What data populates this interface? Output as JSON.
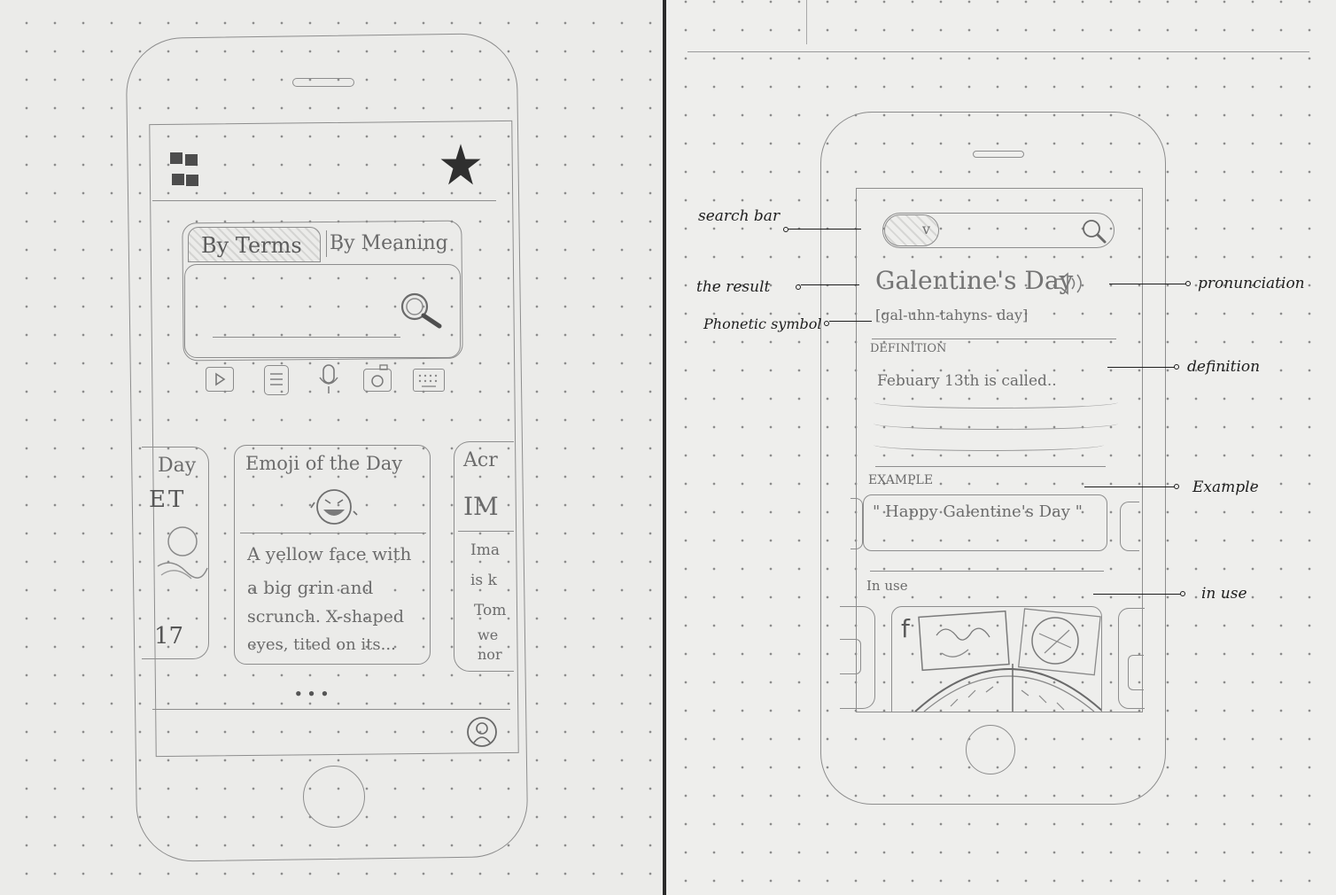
{
  "left_sketch": {
    "tabs": {
      "by_terms": "By Terms",
      "by_meaning": "By Meaning"
    },
    "cards": {
      "left_partial": {
        "title": "Day",
        "big": "ET",
        "bottom": "17"
      },
      "center": {
        "title": "Emoji of the Day",
        "lines": [
          "A yellow face with",
          "a big grin and",
          "scrunch. X-shaped",
          "eyes, tited on its..."
        ]
      },
      "right_partial": {
        "title": "Acr",
        "big": "IM",
        "lines": [
          "Ima",
          "is k",
          "Tom",
          "we",
          "nor"
        ]
      }
    },
    "page_dots": "• • •",
    "toolbar_icons": [
      "video-icon",
      "document-icon",
      "microphone-icon",
      "camera-icon",
      "keyboard-icon"
    ]
  },
  "right_sketch": {
    "search_dropdown": "v",
    "result_title": "Galentine's Day",
    "phonetic": "[gal-uhn-tahyns- day]",
    "definition_label": "DEFINITION",
    "definition_text": "Febuary 13th is called..",
    "example_label": "EXAMPLE",
    "example_text": "\" Happy Galentine's Day \"",
    "in_use_label": "In use"
  },
  "annotations": {
    "search_bar": "search bar",
    "the_result": "the result",
    "phonetic_symbol": "Phonetic symbol",
    "pronunciation": "pronunciation",
    "definition": "definition",
    "example": "Example",
    "in_use": "in use"
  }
}
